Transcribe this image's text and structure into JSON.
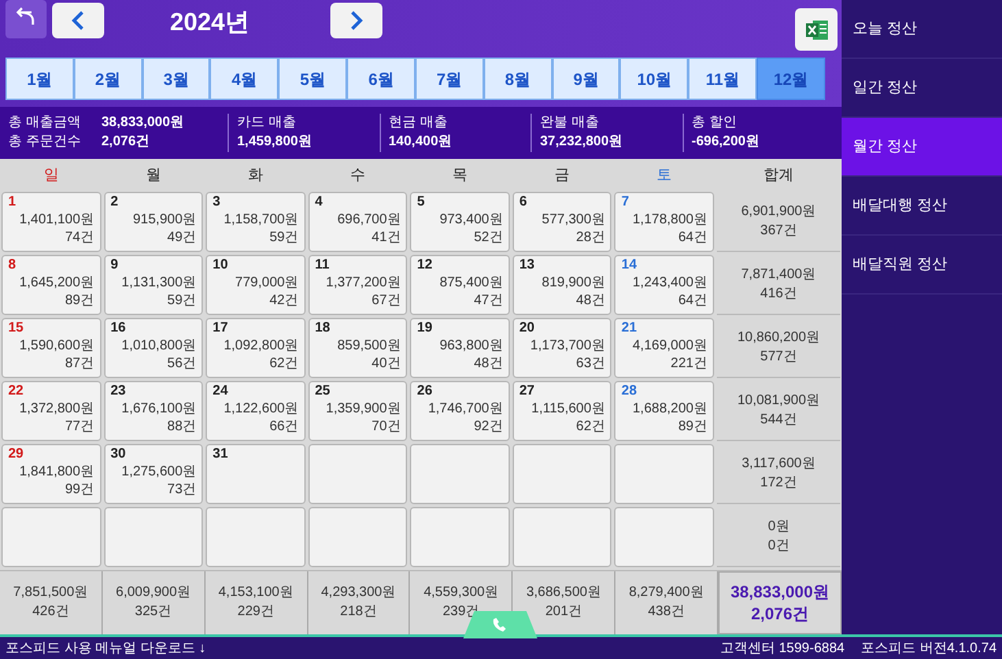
{
  "header": {
    "year": "2024년"
  },
  "months": [
    {
      "label": "1월",
      "selected": false
    },
    {
      "label": "2월",
      "selected": false
    },
    {
      "label": "3월",
      "selected": false
    },
    {
      "label": "4월",
      "selected": false
    },
    {
      "label": "5월",
      "selected": false
    },
    {
      "label": "6월",
      "selected": false
    },
    {
      "label": "7월",
      "selected": false
    },
    {
      "label": "8월",
      "selected": false
    },
    {
      "label": "9월",
      "selected": false
    },
    {
      "label": "10월",
      "selected": false
    },
    {
      "label": "11월",
      "selected": false
    },
    {
      "label": "12월",
      "selected": true
    }
  ],
  "summary": {
    "totals": [
      {
        "label": "총 매출금액",
        "value": "38,833,000원"
      },
      {
        "label": "총 주문건수",
        "value": "2,076건"
      }
    ],
    "breakdown": [
      {
        "label": "카드 매출",
        "value": "1,459,800원"
      },
      {
        "label": "현금 매출",
        "value": "140,400원"
      },
      {
        "label": "완불 매출",
        "value": "37,232,800원"
      },
      {
        "label": "총 할인",
        "value": "-696,200원"
      }
    ]
  },
  "calendar": {
    "weekdays": [
      {
        "label": "일",
        "kind": "sunday"
      },
      {
        "label": "월",
        "kind": "weekday"
      },
      {
        "label": "화",
        "kind": "weekday"
      },
      {
        "label": "수",
        "kind": "weekday"
      },
      {
        "label": "목",
        "kind": "weekday"
      },
      {
        "label": "금",
        "kind": "weekday"
      },
      {
        "label": "토",
        "kind": "saturday"
      }
    ],
    "total_header": "합계",
    "weeks": [
      {
        "days": [
          {
            "day": "1",
            "amount": "1,401,100원",
            "count": "74건"
          },
          {
            "day": "2",
            "amount": "915,900원",
            "count": "49건"
          },
          {
            "day": "3",
            "amount": "1,158,700원",
            "count": "59건"
          },
          {
            "day": "4",
            "amount": "696,700원",
            "count": "41건"
          },
          {
            "day": "5",
            "amount": "973,400원",
            "count": "52건"
          },
          {
            "day": "6",
            "amount": "577,300원",
            "count": "28건"
          },
          {
            "day": "7",
            "amount": "1,178,800원",
            "count": "64건"
          }
        ],
        "total": {
          "amount": "6,901,900원",
          "count": "367건"
        }
      },
      {
        "days": [
          {
            "day": "8",
            "amount": "1,645,200원",
            "count": "89건"
          },
          {
            "day": "9",
            "amount": "1,131,300원",
            "count": "59건"
          },
          {
            "day": "10",
            "amount": "779,000원",
            "count": "42건"
          },
          {
            "day": "11",
            "amount": "1,377,200원",
            "count": "67건"
          },
          {
            "day": "12",
            "amount": "875,400원",
            "count": "47건"
          },
          {
            "day": "13",
            "amount": "819,900원",
            "count": "48건"
          },
          {
            "day": "14",
            "amount": "1,243,400원",
            "count": "64건"
          }
        ],
        "total": {
          "amount": "7,871,400원",
          "count": "416건"
        }
      },
      {
        "days": [
          {
            "day": "15",
            "amount": "1,590,600원",
            "count": "87건"
          },
          {
            "day": "16",
            "amount": "1,010,800원",
            "count": "56건"
          },
          {
            "day": "17",
            "amount": "1,092,800원",
            "count": "62건"
          },
          {
            "day": "18",
            "amount": "859,500원",
            "count": "40건"
          },
          {
            "day": "19",
            "amount": "963,800원",
            "count": "48건"
          },
          {
            "day": "20",
            "amount": "1,173,700원",
            "count": "63건"
          },
          {
            "day": "21",
            "amount": "4,169,000원",
            "count": "221건"
          }
        ],
        "total": {
          "amount": "10,860,200원",
          "count": "577건"
        }
      },
      {
        "days": [
          {
            "day": "22",
            "amount": "1,372,800원",
            "count": "77건"
          },
          {
            "day": "23",
            "amount": "1,676,100원",
            "count": "88건"
          },
          {
            "day": "24",
            "amount": "1,122,600원",
            "count": "66건"
          },
          {
            "day": "25",
            "amount": "1,359,900원",
            "count": "70건"
          },
          {
            "day": "26",
            "amount": "1,746,700원",
            "count": "92건"
          },
          {
            "day": "27",
            "amount": "1,115,600원",
            "count": "62건"
          },
          {
            "day": "28",
            "amount": "1,688,200원",
            "count": "89건"
          }
        ],
        "total": {
          "amount": "10,081,900원",
          "count": "544건"
        }
      },
      {
        "days": [
          {
            "day": "29",
            "amount": "1,841,800원",
            "count": "99건"
          },
          {
            "day": "30",
            "amount": "1,275,600원",
            "count": "73건"
          },
          {
            "day": "31"
          }
        ],
        "total": {
          "amount": "3,117,600원",
          "count": "172건"
        }
      },
      {
        "total": {
          "amount": "0원",
          "count": "0건"
        }
      }
    ],
    "column_totals": [
      {
        "amount": "7,851,500원",
        "count": "426건"
      },
      {
        "amount": "6,009,900원",
        "count": "325건"
      },
      {
        "amount": "4,153,100원",
        "count": "229건"
      },
      {
        "amount": "4,293,300원",
        "count": "218건"
      },
      {
        "amount": "4,559,300원",
        "count": "239건"
      },
      {
        "amount": "3,686,500원",
        "count": "201건"
      },
      {
        "amount": "8,279,400원",
        "count": "438건"
      }
    ],
    "grand_total": {
      "amount": "38,833,000원",
      "count": "2,076건"
    }
  },
  "sidebar": {
    "items": [
      {
        "label": "오늘 정산",
        "selected": false
      },
      {
        "label": "일간 정산",
        "selected": false
      },
      {
        "label": "월간 정산",
        "selected": true
      },
      {
        "label": "배달대행 정산",
        "selected": false
      },
      {
        "label": "배달직원 정산",
        "selected": false
      }
    ]
  },
  "footer": {
    "manual_link": "포스피드 사용 메뉴얼 다운로드 ↓",
    "support": "고객센터 1599-6884",
    "version": "포스피드 버전4.1.0.74"
  }
}
